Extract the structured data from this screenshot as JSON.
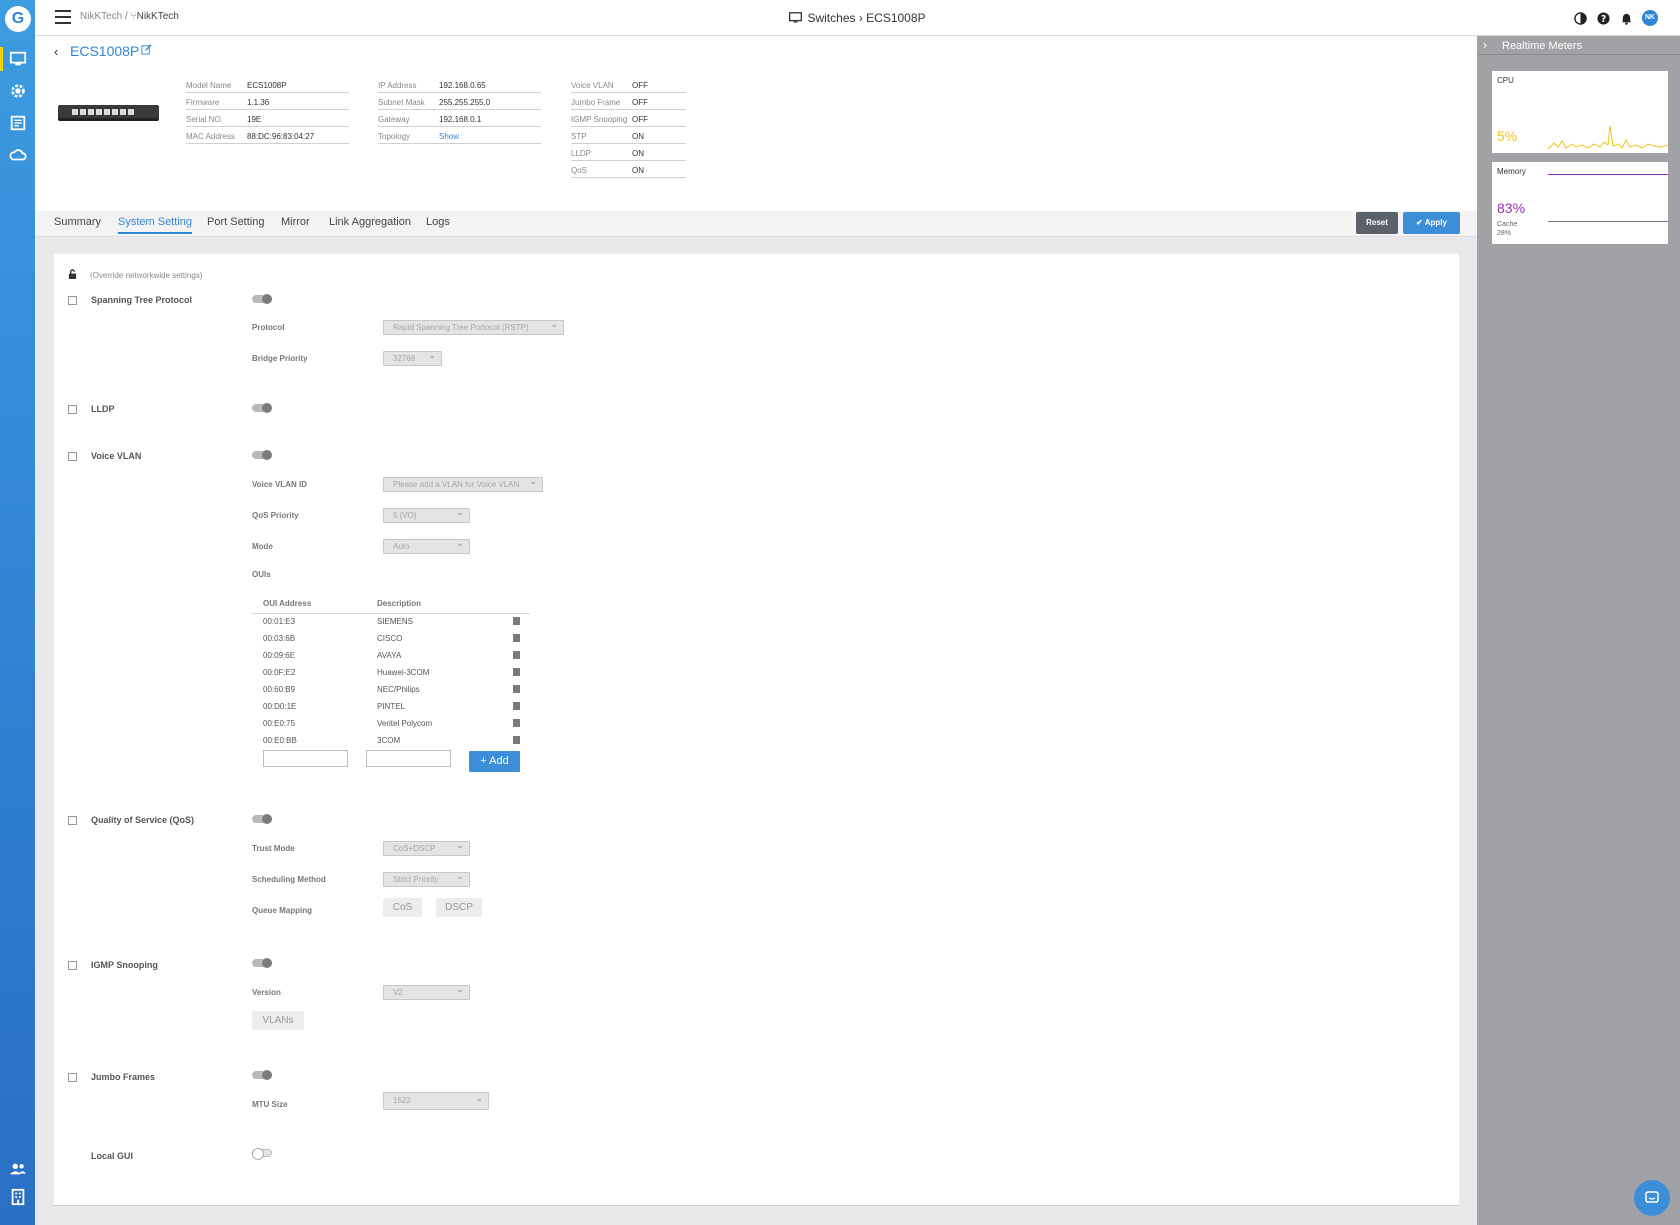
{
  "header": {
    "breadcrumb_org": "NikKTech",
    "breadcrumb_sep": "/",
    "breadcrumb_site": "NikKTech",
    "page_title": "Switches › ECS1008P",
    "avatar_initials": "NK"
  },
  "device": {
    "name": "ECS1008P",
    "info_col1": [
      {
        "label": "Model Name",
        "value": "ECS1008P"
      },
      {
        "label": "Firmware",
        "value": "1.1.36"
      },
      {
        "label": "Serial NO.",
        "value": "19E"
      },
      {
        "label": "MAC Address",
        "value": "88:DC:96:83:04:27"
      }
    ],
    "info_col2": [
      {
        "label": "IP Address",
        "value": "192.168.0.65"
      },
      {
        "label": "Subnet Mask",
        "value": "255.255.255.0"
      },
      {
        "label": "Gateway",
        "value": "192.168.0.1"
      },
      {
        "label": "Topology",
        "value": "Show"
      }
    ],
    "info_col3": [
      {
        "label": "Voice VLAN",
        "value": "OFF"
      },
      {
        "label": "Jumbo Frame",
        "value": "OFF"
      },
      {
        "label": "IGMP Snooping",
        "value": "OFF"
      },
      {
        "label": "STP",
        "value": "ON"
      },
      {
        "label": "LLDP",
        "value": "ON"
      },
      {
        "label": "QoS",
        "value": "ON"
      }
    ]
  },
  "tabs": [
    "Summary",
    "System Setting",
    "Port Setting",
    "Mirror",
    "Link Aggregation",
    "Logs"
  ],
  "active_tab": "System Setting",
  "actions": {
    "reset": "Reset",
    "apply": "Apply"
  },
  "settings": {
    "override_note": "(Override networkwide settings)",
    "stp": {
      "label": "Spanning Tree Protocol",
      "protocol_label": "Protocol",
      "protocol_value": "Rapid Spanning Tree Portocol (RSTP)",
      "bridge_label": "Bridge Priority",
      "bridge_value": "32768"
    },
    "lldp": {
      "label": "LLDP"
    },
    "voice_vlan": {
      "label": "Voice VLAN",
      "id_label": "Voice VLAN ID",
      "id_value": "Please add a VLAN for Voice VLAN",
      "qos_label": "QoS Priority",
      "qos_value": "5 (VO)",
      "mode_label": "Mode",
      "mode_value": "Auto",
      "ouis_label": "OUIs",
      "oui_col_address": "OUI Address",
      "oui_col_description": "Description",
      "ouis": [
        {
          "address": "00:01:E3",
          "description": "SIEMENS"
        },
        {
          "address": "00:03:6B",
          "description": "CISCO"
        },
        {
          "address": "00:09:6E",
          "description": "AVAYA"
        },
        {
          "address": "00:0F:E2",
          "description": "Huawei-3COM"
        },
        {
          "address": "00:60:B9",
          "description": "NEC/Philips"
        },
        {
          "address": "00:D0:1E",
          "description": "PINTEL"
        },
        {
          "address": "00:E0:75",
          "description": "Veritel Polycom"
        },
        {
          "address": "00:E0:BB",
          "description": "3COM"
        }
      ],
      "add_label": "+ Add"
    },
    "qos": {
      "label": "Quality of Service (QoS)",
      "trust_label": "Trust Mode",
      "trust_value": "CoS+DSCP",
      "sched_label": "Scheduling Method",
      "sched_value": "Strict Priority",
      "queue_label": "Queue Mapping",
      "cos_btn": "CoS",
      "dscp_btn": "DSCP"
    },
    "igmp": {
      "label": "IGMP Snooping",
      "version_label": "Version",
      "version_value": "V2",
      "vlans_btn": "VLANs"
    },
    "jumbo": {
      "label": "Jumbo Frames",
      "mtu_label": "MTU Size",
      "mtu_value": "1522"
    },
    "local_gui": {
      "label": "Local GUI"
    }
  },
  "realtime": {
    "title": "Realtime Meters",
    "cpu": {
      "label": "CPU",
      "percent": "5%",
      "color": "#f0c419"
    },
    "memory": {
      "label": "Memory",
      "percent": "83%",
      "cache_label": "Cache",
      "cache_value": "28%",
      "color": "#9b2fb5"
    }
  },
  "colors": {
    "accent": "#2f86d6",
    "rail_highlight": "#f5d20a"
  }
}
